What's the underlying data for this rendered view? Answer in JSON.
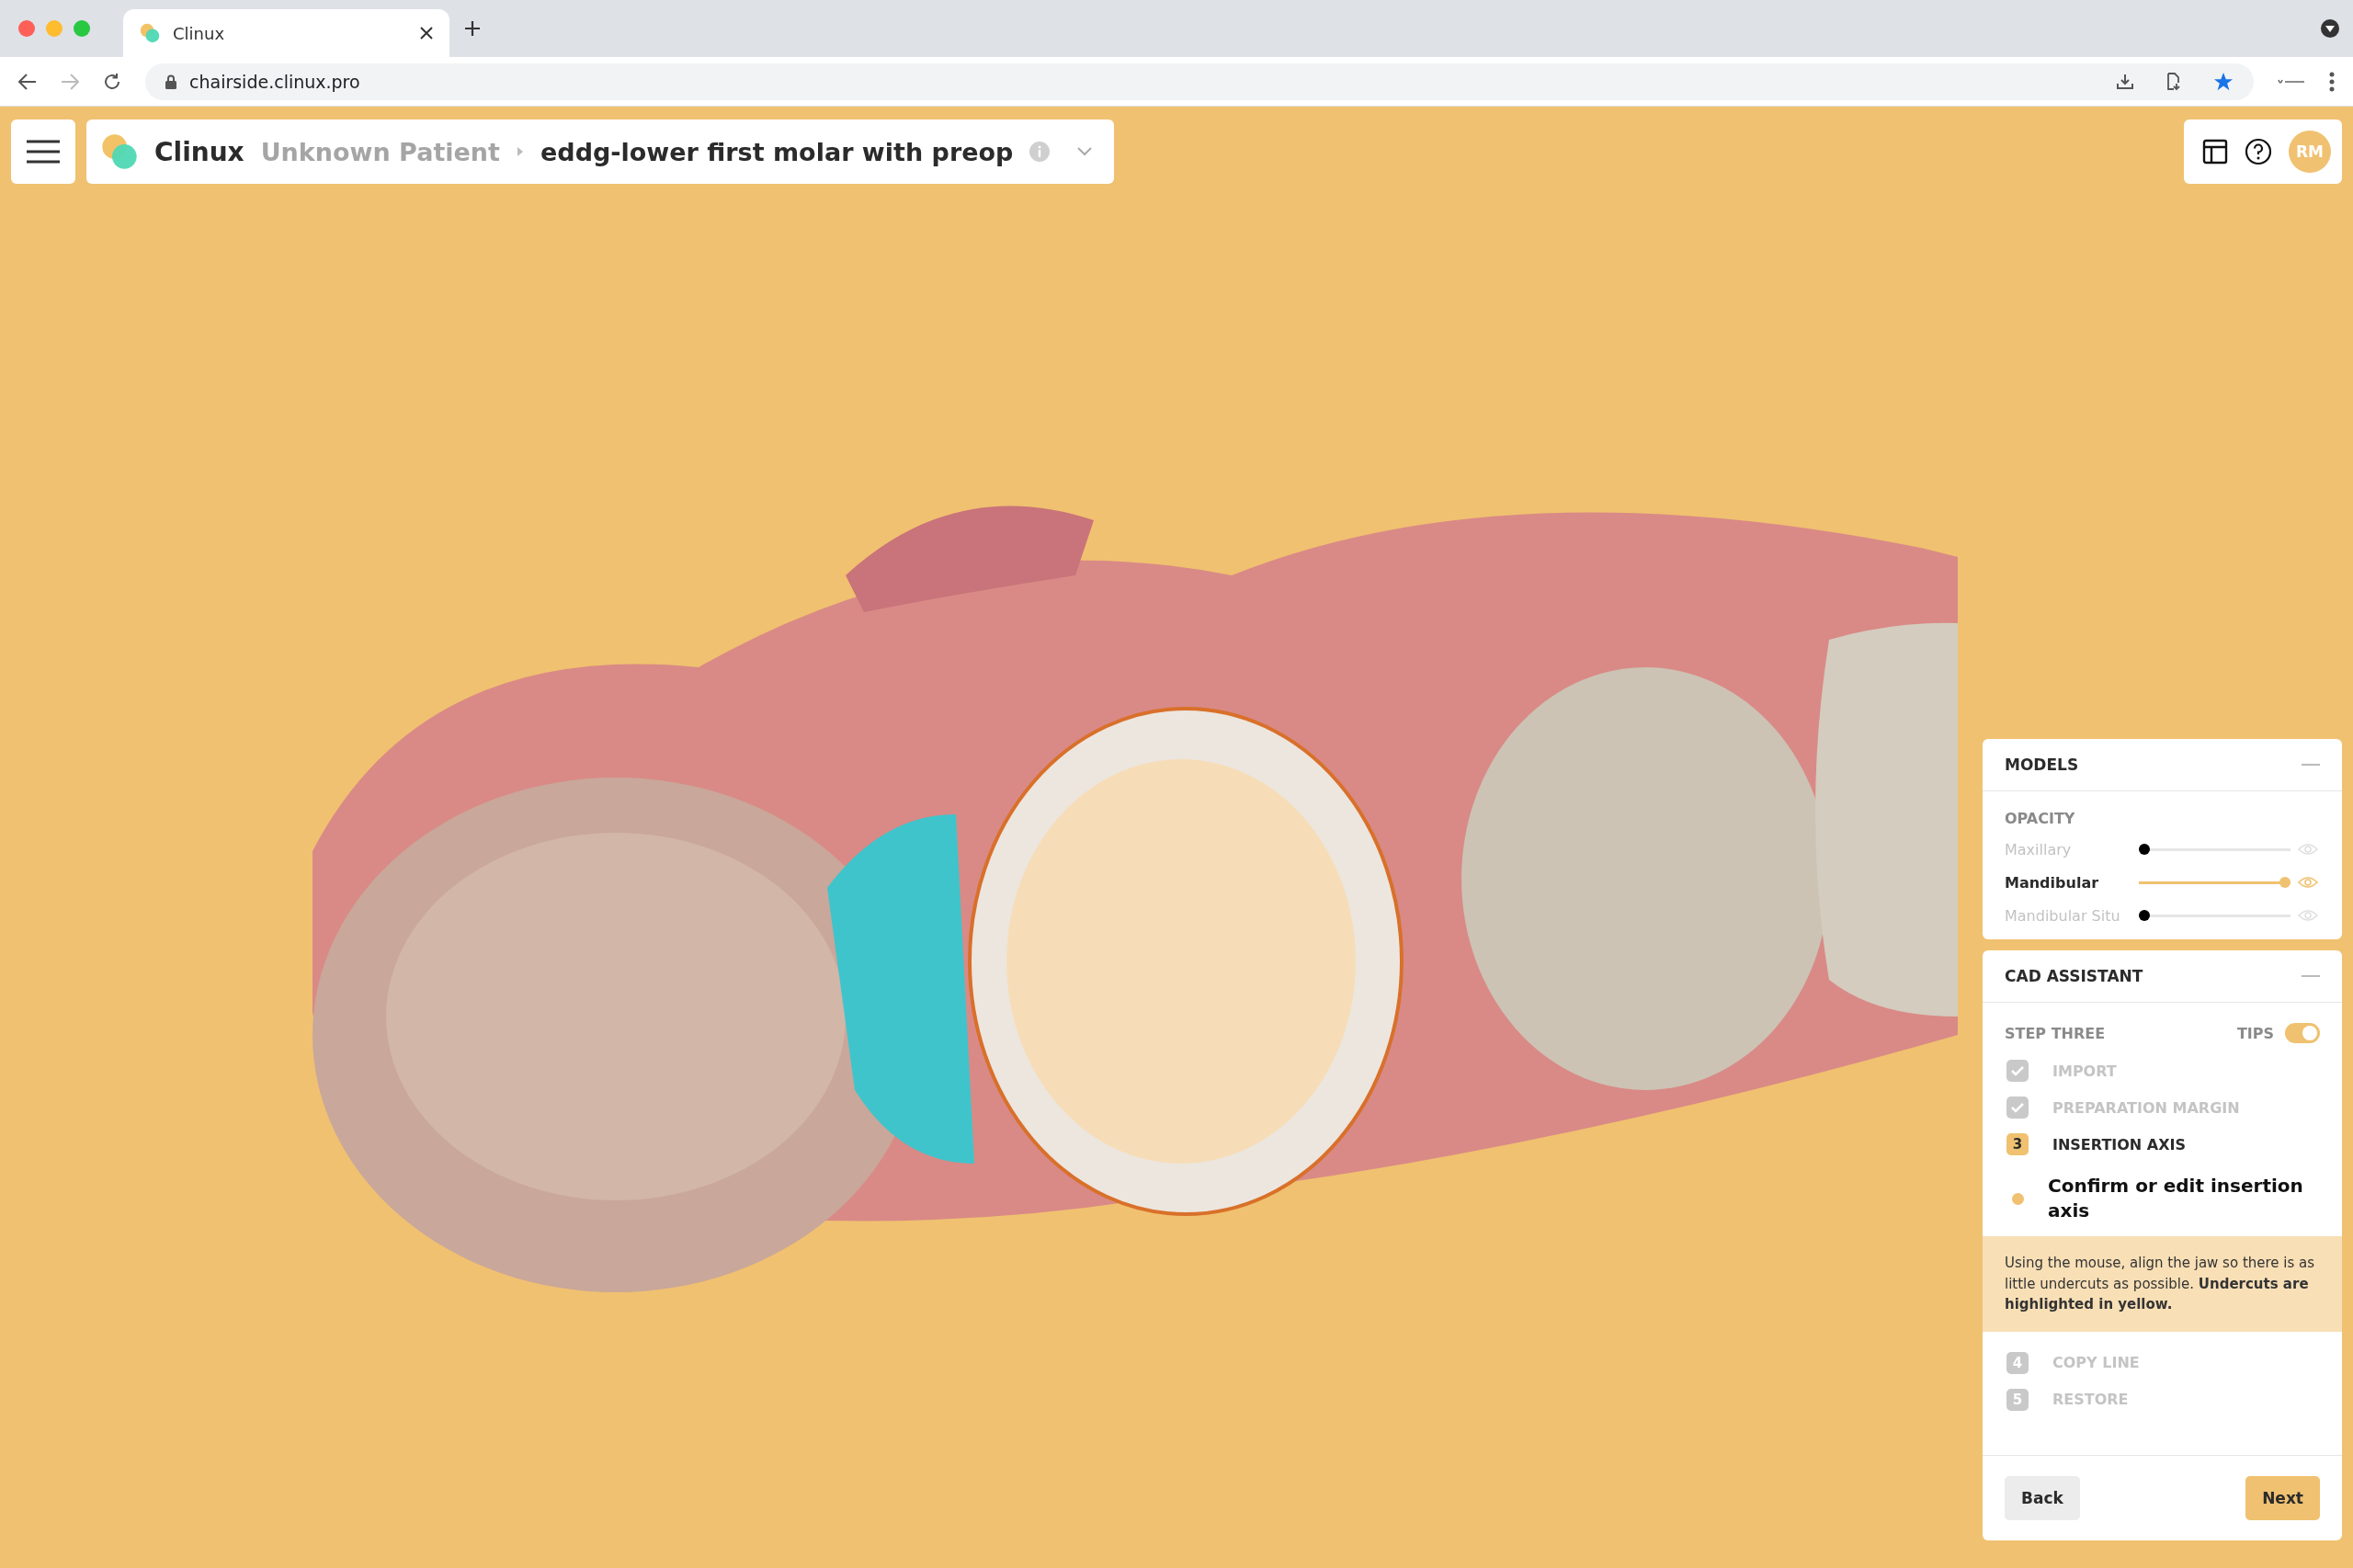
{
  "browser": {
    "tab_title": "Clinux",
    "url": "chairside.clinux.pro"
  },
  "header": {
    "brand": "Clinux",
    "patient": "Unknown Patient",
    "case": "eddg-lower first molar with preop",
    "avatar": "RM"
  },
  "models": {
    "title": "MODELS",
    "section": "OPACITY",
    "sliders": [
      {
        "name": "Maxillary",
        "level": 0,
        "visible": false
      },
      {
        "name": "Mandibular",
        "level": 1,
        "visible": true
      },
      {
        "name": "Mandibular Situ",
        "level": 0,
        "visible": false
      }
    ]
  },
  "assistant": {
    "title": "CAD ASSISTANT",
    "step_label": "STEP THREE",
    "tips_label": "TIPS",
    "tips_on": true,
    "steps": [
      {
        "kind": "done",
        "label": "IMPORT"
      },
      {
        "kind": "done",
        "label": "PREPARATION MARGIN"
      },
      {
        "kind": "current",
        "number": "3",
        "label": "INSERTION AXIS",
        "task": "Confirm or edit insertion axis",
        "tip": "Using the mouse, align the jaw so there is as little undercuts as possible. **Undercuts are highlighted in yellow.**"
      },
      {
        "kind": "pending",
        "number": "4",
        "label": "COPY LINE"
      },
      {
        "kind": "pending",
        "number": "5",
        "label": "RESTORE"
      }
    ],
    "buttons": {
      "back": "Back",
      "next": "Next"
    }
  }
}
